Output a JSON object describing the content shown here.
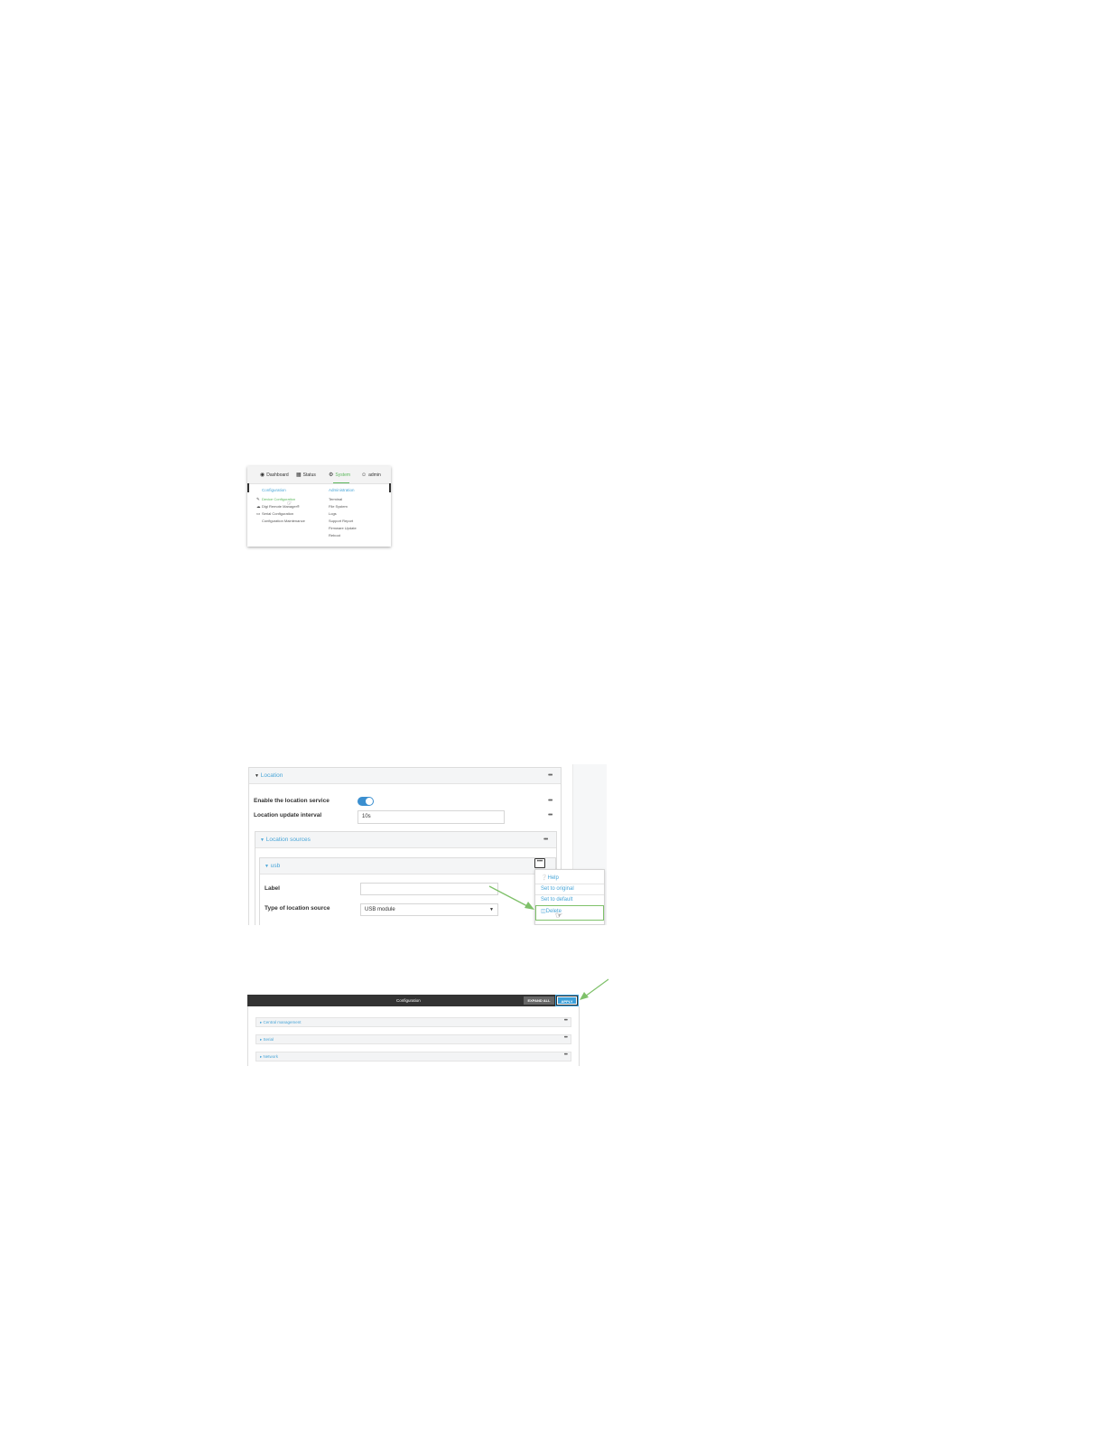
{
  "nav": {
    "items": [
      {
        "label": "Dashboard",
        "icon": "dashboard-icon"
      },
      {
        "label": "Status",
        "icon": "grid-icon"
      },
      {
        "label": "System",
        "icon": "gear-icon"
      },
      {
        "label": "admin",
        "icon": "user-icon"
      }
    ],
    "active_color": "#5cb85c"
  },
  "system_menu": {
    "configuration_header": "Configuration",
    "configuration_items": [
      "Device Configuration",
      "Digi Remote Manager®",
      "Serial Configuration",
      "Configuration Maintenance"
    ],
    "administration_header": "Administration",
    "administration_items": [
      "Terminal",
      "File System",
      "Logs",
      "Support Report",
      "Firmware Update",
      "Reboot"
    ]
  },
  "location": {
    "title": "Location",
    "enable_label": "Enable the location service",
    "enable_state": true,
    "interval_label": "Location update interval",
    "interval_value": "10s",
    "sources_title": "Location sources",
    "usb_title": "usb",
    "label_field_label": "Label",
    "label_value": "",
    "type_label": "Type of location source",
    "type_value": "USB module",
    "context_menu": {
      "help": "Help",
      "set_original": "Set to original",
      "set_default": "Set to default",
      "delete": "Delete"
    }
  },
  "configuration_bar": {
    "title": "Configuration",
    "expand_all": "EXPAND ALL",
    "apply": "APPLY",
    "sections": [
      "Central management",
      "Serial",
      "Network"
    ]
  },
  "colors": {
    "accent_blue": "#4aa6d8",
    "apply_blue": "#3b9fd9",
    "arrow_green": "#7fc16a",
    "dark_bar": "#333333"
  }
}
